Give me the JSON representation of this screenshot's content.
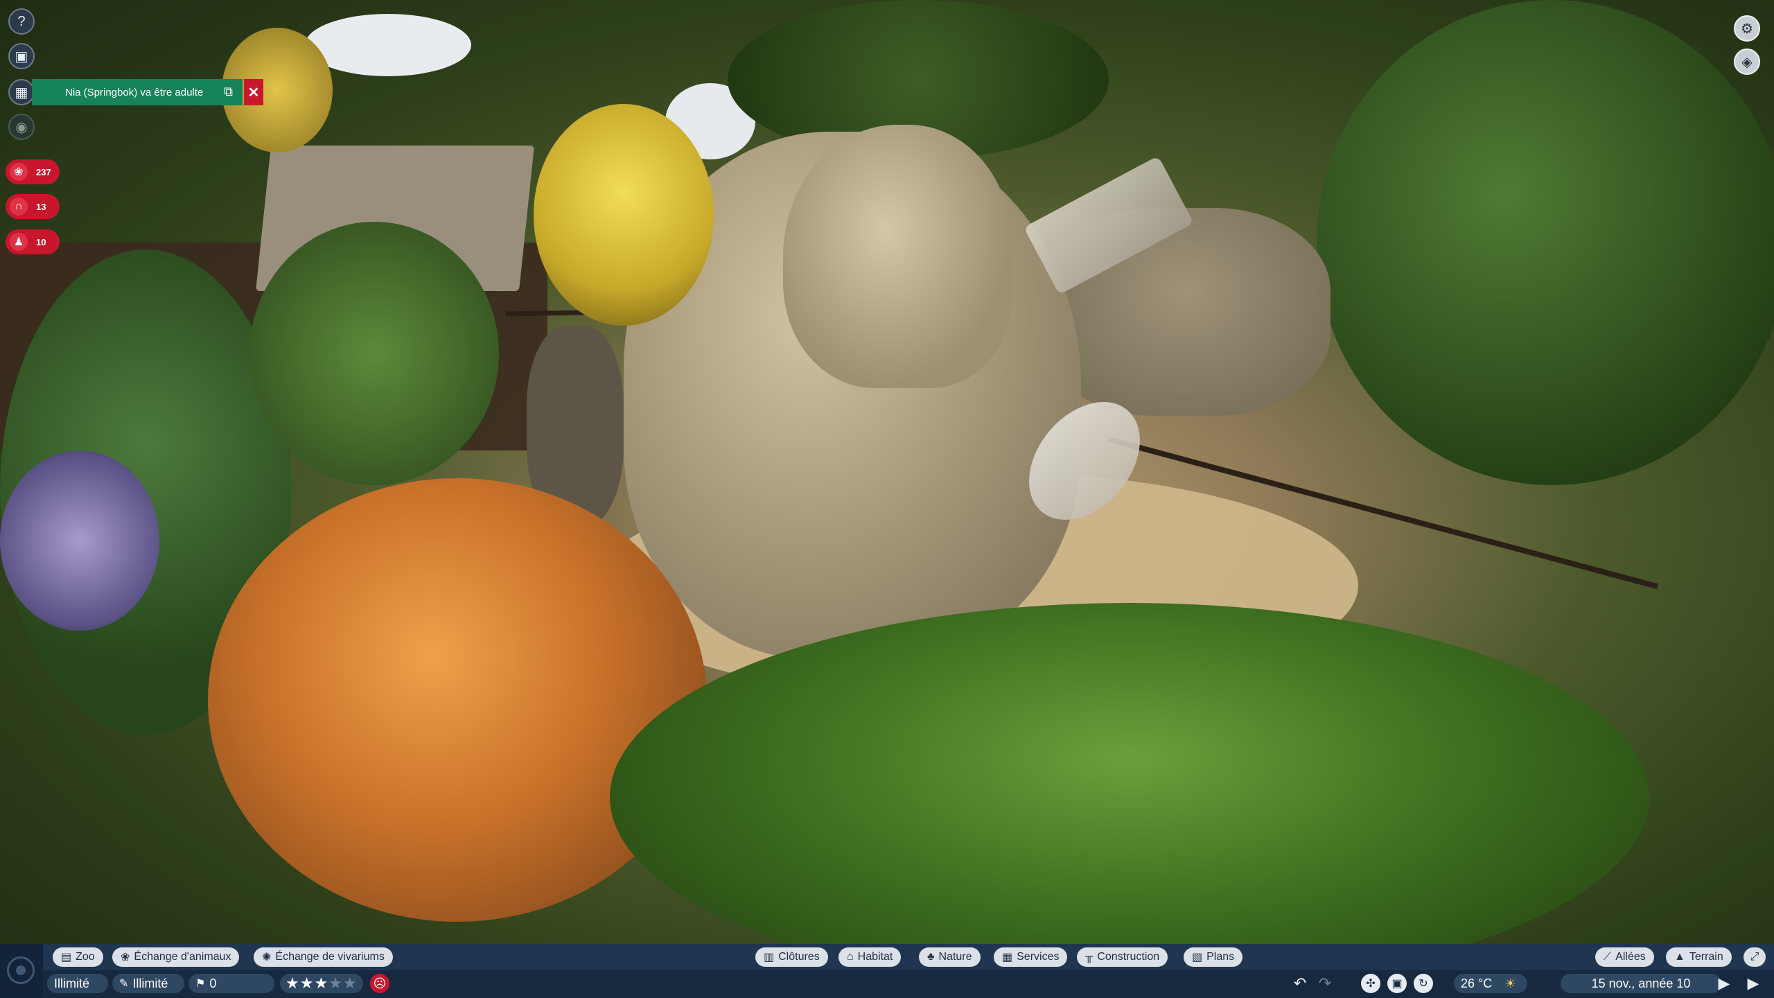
{
  "notification": {
    "text": "Nia (Springbok) va être adulte",
    "open_icon": "external-link-icon",
    "close_symbol": "✕"
  },
  "sidebar": {
    "help_icon": "question-icon",
    "animals_icon": "paw-frame-icon",
    "calendar_icon": "calendar-icon",
    "view_icon": "eye-icon",
    "stats": [
      {
        "icon": "paw-icon",
        "value": "237"
      },
      {
        "icon": "arch-icon",
        "value": "13"
      },
      {
        "icon": "staff-icon",
        "value": "10"
      }
    ]
  },
  "topright": {
    "settings_icon": "gear-icon",
    "overlay_icon": "layers-icon"
  },
  "toolbar": {
    "left": [
      {
        "label": "Zoo",
        "icon": "zoo-icon"
      },
      {
        "label": "Échange d'animaux",
        "icon": "paw-icon"
      },
      {
        "label": "Échange de vivariums",
        "icon": "sun-icon"
      }
    ],
    "center": [
      {
        "label": "Clôtures",
        "icon": "fence-icon"
      },
      {
        "label": "Habitat",
        "icon": "habitat-icon"
      },
      {
        "label": "Nature",
        "icon": "tree-icon"
      },
      {
        "label": "Services",
        "icon": "building-icon"
      },
      {
        "label": "Construction",
        "icon": "construction-icon"
      },
      {
        "label": "Plans",
        "icon": "blueprint-icon"
      }
    ],
    "right": [
      {
        "label": "Allées",
        "icon": "path-icon"
      },
      {
        "label": "Terrain",
        "icon": "terrain-icon"
      }
    ]
  },
  "statusbar": {
    "money": "Illimité",
    "research": "Illimité",
    "guests_alert": "0",
    "rating_stars": 3,
    "rating_max": 5,
    "temperature": "26 °C",
    "date": "15 nov., année 10"
  },
  "colors": {
    "accent_red": "#c8172d",
    "notification_green": "#17835a",
    "bar_blue": "#1f3550"
  }
}
